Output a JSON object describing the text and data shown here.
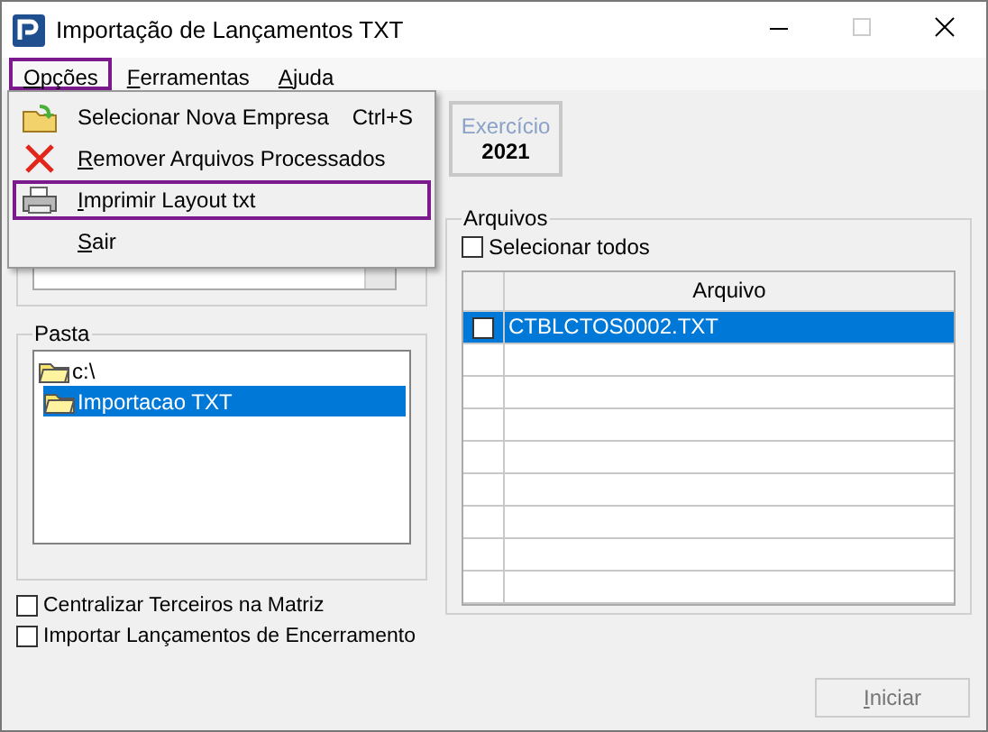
{
  "window": {
    "title": "Importação de Lançamentos TXT"
  },
  "menu_bar": [
    {
      "label": "Opções",
      "mnemonic": true,
      "selected": true
    },
    {
      "label": "Ferramentas",
      "mnemonic": true,
      "selected": false
    },
    {
      "label": "Ajuda",
      "mnemonic": true,
      "selected": false
    }
  ],
  "open_menu": [
    {
      "kind": "folder",
      "label": "Selecionar Nova Empresa",
      "shortcut": "Ctrl+S",
      "mnemonic": false,
      "selected": false
    },
    {
      "kind": "remove",
      "label": "Remover Arquivos Processados",
      "mnemonic": true,
      "selected": false
    },
    {
      "kind": "printer",
      "label": "Imprimir Layout txt",
      "mnemonic": true,
      "selected": true
    },
    {
      "kind": "plain",
      "label": "Sair",
      "mnemonic": true,
      "selected": false
    }
  ],
  "exercicio": {
    "label": "Exercício",
    "value": "2021"
  },
  "pasta": {
    "title": "Pasta",
    "tree": [
      {
        "label": "c:\\",
        "selected": false,
        "children": [
          {
            "label": "Importacao TXT",
            "selected": true
          }
        ]
      }
    ]
  },
  "options": [
    {
      "label": "Centralizar Terceiros na Matriz",
      "checked": false
    },
    {
      "label": "Importar Lançamentos de Encerramento",
      "checked": false
    }
  ],
  "arquivos": {
    "title": "Arquivos",
    "select_all": {
      "label": "Selecionar todos",
      "checked": false
    },
    "column": "Arquivo",
    "rows": [
      {
        "name": "CTBLCTOS0002.TXT",
        "checked": false,
        "selected": true
      }
    ]
  },
  "buttons": [
    {
      "label": "Iniciar",
      "mnemonic": true,
      "disabled": true
    }
  ]
}
